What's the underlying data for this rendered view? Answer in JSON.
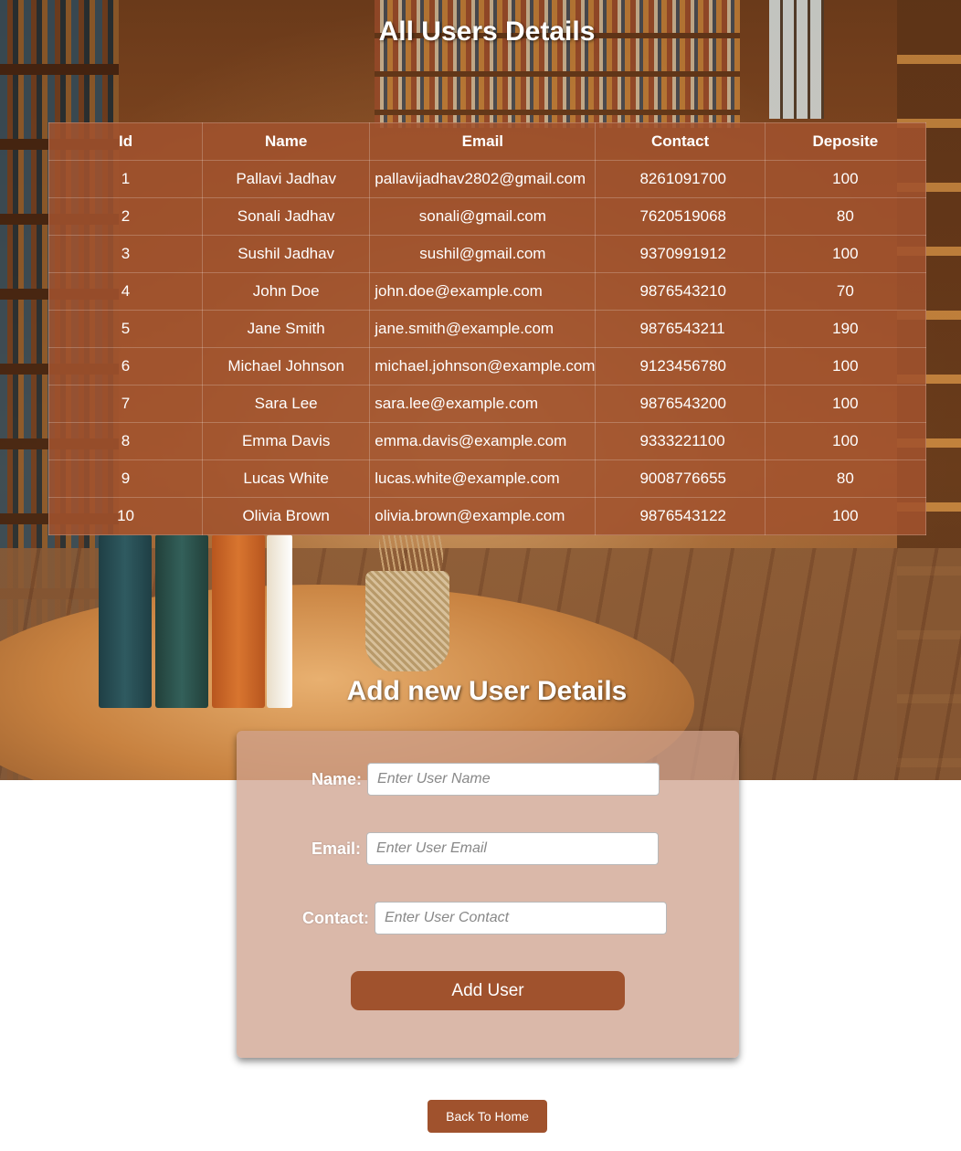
{
  "page": {
    "title": "All Users Details"
  },
  "table": {
    "headers": [
      "Id",
      "Name",
      "Email",
      "Contact",
      "Deposite"
    ],
    "rows": [
      {
        "id": "1",
        "name": "Pallavi Jadhav",
        "email": "pallavijadhav2802@gmail.com",
        "contact": "8261091700",
        "deposite": "100"
      },
      {
        "id": "2",
        "name": "Sonali Jadhav",
        "email": "sonali@gmail.com",
        "contact": "7620519068",
        "deposite": "80"
      },
      {
        "id": "3",
        "name": "Sushil Jadhav",
        "email": "sushil@gmail.com",
        "contact": "9370991912",
        "deposite": "100"
      },
      {
        "id": "4",
        "name": "John Doe",
        "email": "john.doe@example.com",
        "contact": "9876543210",
        "deposite": "70"
      },
      {
        "id": "5",
        "name": "Jane Smith",
        "email": "jane.smith@example.com",
        "contact": "9876543211",
        "deposite": "190"
      },
      {
        "id": "6",
        "name": "Michael Johnson",
        "email": "michael.johnson@example.com",
        "contact": "9123456780",
        "deposite": "100"
      },
      {
        "id": "7",
        "name": "Sara Lee",
        "email": "sara.lee@example.com",
        "contact": "9876543200",
        "deposite": "100"
      },
      {
        "id": "8",
        "name": "Emma Davis",
        "email": "emma.davis@example.com",
        "contact": "9333221100",
        "deposite": "100"
      },
      {
        "id": "9",
        "name": "Lucas White",
        "email": "lucas.white@example.com",
        "contact": "9008776655",
        "deposite": "80"
      },
      {
        "id": "10",
        "name": "Olivia Brown",
        "email": "olivia.brown@example.com",
        "contact": "9876543122",
        "deposite": "100"
      }
    ]
  },
  "form": {
    "title": "Add new User Details",
    "name_label": "Name:",
    "name_placeholder": "Enter User Name",
    "name_value": "",
    "email_label": "Email:",
    "email_placeholder": "Enter User Email",
    "email_value": "",
    "contact_label": "Contact:",
    "contact_placeholder": "Enter User Contact",
    "contact_value": "",
    "submit_label": "Add User"
  },
  "footer": {
    "back_label": "Back To Home"
  },
  "colors": {
    "accent": "#a0522d",
    "table_bg": "#a0522d",
    "card_bg": "#d9b8aa",
    "text_on_accent": "#ffffff"
  }
}
